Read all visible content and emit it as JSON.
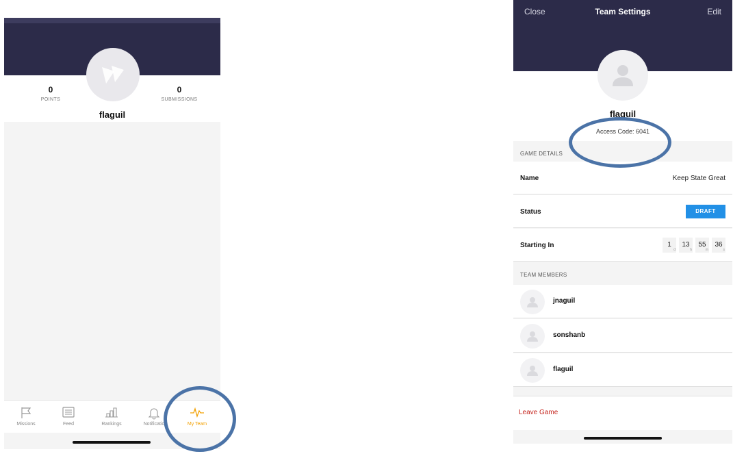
{
  "left_screen": {
    "points": {
      "value": "0",
      "label": "POINTS"
    },
    "submissions": {
      "value": "0",
      "label": "SUBMISSIONS"
    },
    "username": "flaguil",
    "tabs": [
      {
        "label": "Missions",
        "icon": "flag-icon"
      },
      {
        "label": "Feed",
        "icon": "feed-icon"
      },
      {
        "label": "Rankings",
        "icon": "rankings-icon"
      },
      {
        "label": "Notificatio",
        "icon": "bell-icon"
      },
      {
        "label": "My Team",
        "icon": "activity-icon",
        "active": true
      }
    ],
    "active_color": "#f2a000"
  },
  "right_screen": {
    "nav": {
      "close": "Close",
      "title": "Team Settings",
      "edit": "Edit"
    },
    "team_name": "flaguil",
    "access_code": "Access Code: 6041",
    "game_details_header": "GAME DETAILS",
    "name_label": "Name",
    "name_value": "Keep State Great",
    "status_label": "Status",
    "status_value": "DRAFT",
    "starting_label": "Starting In",
    "countdown": [
      {
        "value": "1",
        "unit": "d"
      },
      {
        "value": "13",
        "unit": "h"
      },
      {
        "value": "55",
        "unit": "m"
      },
      {
        "value": "36",
        "unit": "s"
      }
    ],
    "team_members_header": "TEAM MEMBERS",
    "members": [
      "jnaguil",
      "sonshanb",
      "flaguil"
    ],
    "leave": "Leave Game",
    "colors": {
      "header": "#2c2b49",
      "badge": "#2290e6",
      "leave": "#c5261f",
      "highlight": "#4b73a7"
    }
  }
}
